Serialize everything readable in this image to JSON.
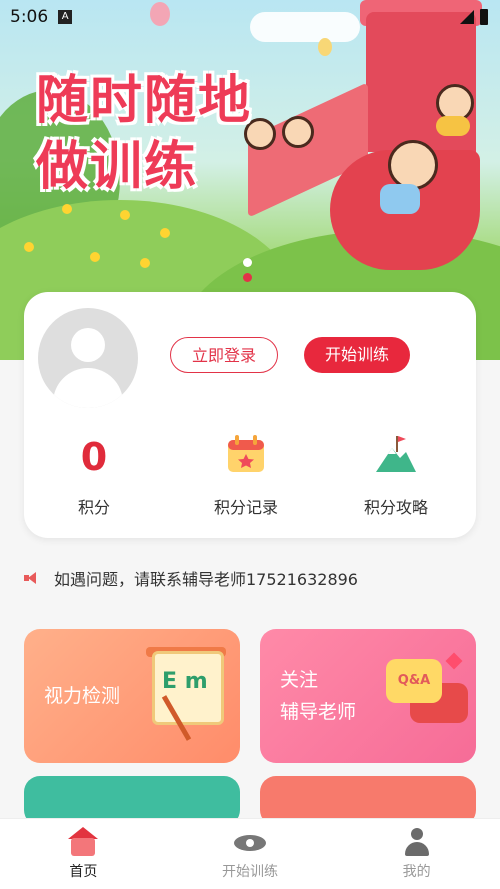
{
  "status_bar": {
    "time": "5:06",
    "notification_icon": "A"
  },
  "banner": {
    "title_line1": "随时随地",
    "title_line2": "做训练",
    "carousel_total": 2,
    "carousel_active": 2
  },
  "user_card": {
    "login_label": "立即登录",
    "start_label": "开始训练",
    "stats": [
      {
        "value": "0",
        "label": "积分"
      },
      {
        "icon": "calendar-icon",
        "label": "积分记录"
      },
      {
        "icon": "mountain-flag-icon",
        "label": "积分攻略"
      }
    ]
  },
  "notice": {
    "text": "如遇问题，请联系辅导老师17521632896"
  },
  "tiles": [
    {
      "line1": "视力检测",
      "line2": "",
      "icon": "eye-chart-board-icon"
    },
    {
      "line1": "关注",
      "line2": "辅导老师",
      "icon": "qa-bubble-icon"
    }
  ],
  "tab_bar": {
    "tabs": [
      {
        "label": "首页",
        "icon": "home-icon",
        "active": true
      },
      {
        "label": "开始训练",
        "icon": "eye-icon",
        "active": false
      },
      {
        "label": "我的",
        "icon": "user-icon",
        "active": false
      }
    ]
  },
  "colors": {
    "primary_red": "#e8283d",
    "tile_eye": "#ff9a76",
    "tile_teacher": "#f77aa0",
    "tile_green": "#3fbd9f",
    "tile_coral": "#f77a6c"
  }
}
